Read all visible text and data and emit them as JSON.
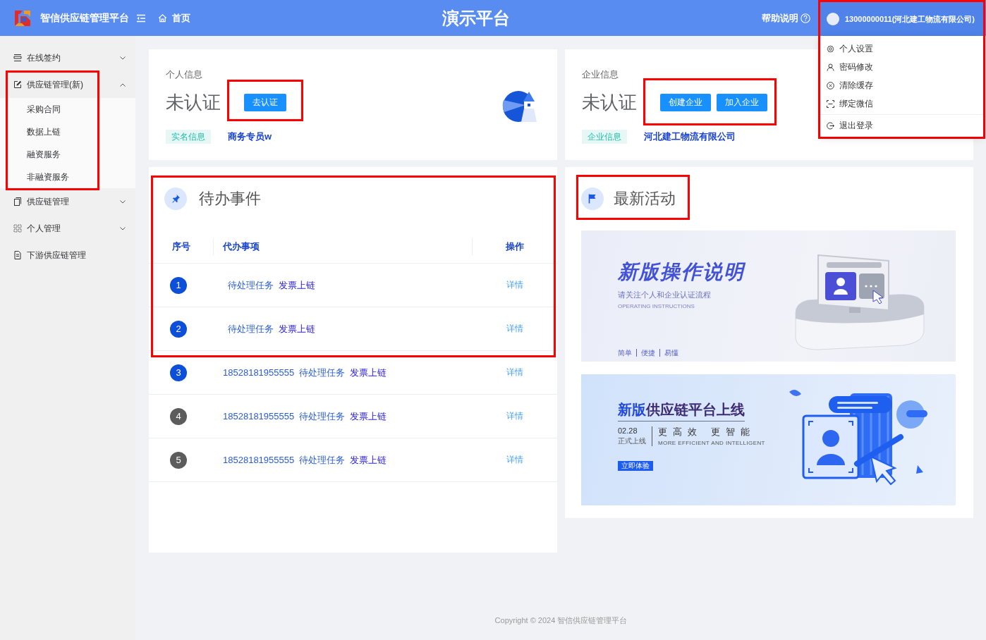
{
  "header": {
    "app_title": "智信供应链管理平台",
    "home": "首页",
    "center_title": "演示平台",
    "help": "帮助说明",
    "account": "13000000011(河北建工物流有限公司)"
  },
  "user_menu": {
    "highlighted": true,
    "sections": [
      {
        "items": [
          {
            "label": "个人设置"
          },
          {
            "label": "密码修改"
          },
          {
            "label": "清除缓存"
          },
          {
            "label": "绑定微信"
          }
        ]
      },
      {
        "items": [
          {
            "label": "退出登录"
          }
        ]
      }
    ]
  },
  "sidebar": {
    "items": [
      {
        "label": "在线签约",
        "expanded": false,
        "highlighted": false
      },
      {
        "label": "供应链管理(新)",
        "expanded": true,
        "highlighted": true,
        "children": [
          {
            "label": "采购合同"
          },
          {
            "label": "数据上链"
          },
          {
            "label": "融资服务"
          },
          {
            "label": "非融资服务"
          }
        ]
      },
      {
        "label": "供应链管理",
        "expanded": false,
        "highlighted": false
      },
      {
        "label": "个人管理",
        "expanded": false,
        "highlighted": false
      },
      {
        "label": "下游供应链管理",
        "highlighted": false
      }
    ]
  },
  "personal_info": {
    "title": "个人信息",
    "status": "未认证",
    "buttons": [
      {
        "label": "去认证"
      }
    ],
    "highlighted": true,
    "tag": "实名信息",
    "value": "商务专员w"
  },
  "company_info": {
    "title": "企业信息",
    "status": "未认证",
    "buttons": [
      {
        "label": "创建企业"
      },
      {
        "label": "加入企业"
      }
    ],
    "highlighted": true,
    "tag": "企业信息",
    "value": "河北建工物流有限公司"
  },
  "todo": {
    "title": "待办事件",
    "highlighted": true,
    "columns": [
      "序号",
      "代办事项",
      "操作"
    ],
    "rows": [
      {
        "index": "1",
        "color": "#0d4fd8",
        "task": "待处理任务",
        "item": "发票上链",
        "action": "详情"
      },
      {
        "index": "2",
        "color": "#0d4fd8",
        "task": "待处理任务",
        "item": "发票上链",
        "action": "详情"
      },
      {
        "index": "3",
        "color": "#0d4fd8",
        "phone": "18528181955555",
        "task": "待处理任务",
        "item": "发票上链",
        "action": "详情"
      },
      {
        "index": "4",
        "color": "#5c5c5c",
        "phone": "18528181955555",
        "task": "待处理任务",
        "item": "发票上链",
        "action": "详情"
      },
      {
        "index": "5",
        "color": "#5c5c5c",
        "phone": "18528181955555",
        "task": "待处理任务",
        "item": "发票上链",
        "action": "详情"
      }
    ]
  },
  "activity": {
    "title": "最新活动",
    "highlighted": true,
    "banners": [
      {
        "kind": "guide",
        "title": "新版操作说明",
        "subtitle": "请关注个人和企业认证流程",
        "caption": "OPERATING INSTRUCTIONS",
        "tags": [
          "简单",
          "便捷",
          "易懂"
        ]
      },
      {
        "kind": "launch",
        "title_lead": "新版",
        "title_rest": "供应链平台上线",
        "date": "02.28",
        "date_caption": "正式上线",
        "slogan": "更高效 更智能",
        "caption": "MORE EFFICIENT AND INTELLIGENT",
        "button": "立即体验"
      }
    ]
  },
  "footer": {
    "copyright": "Copyright © 2024 智信供应链管理平台"
  }
}
